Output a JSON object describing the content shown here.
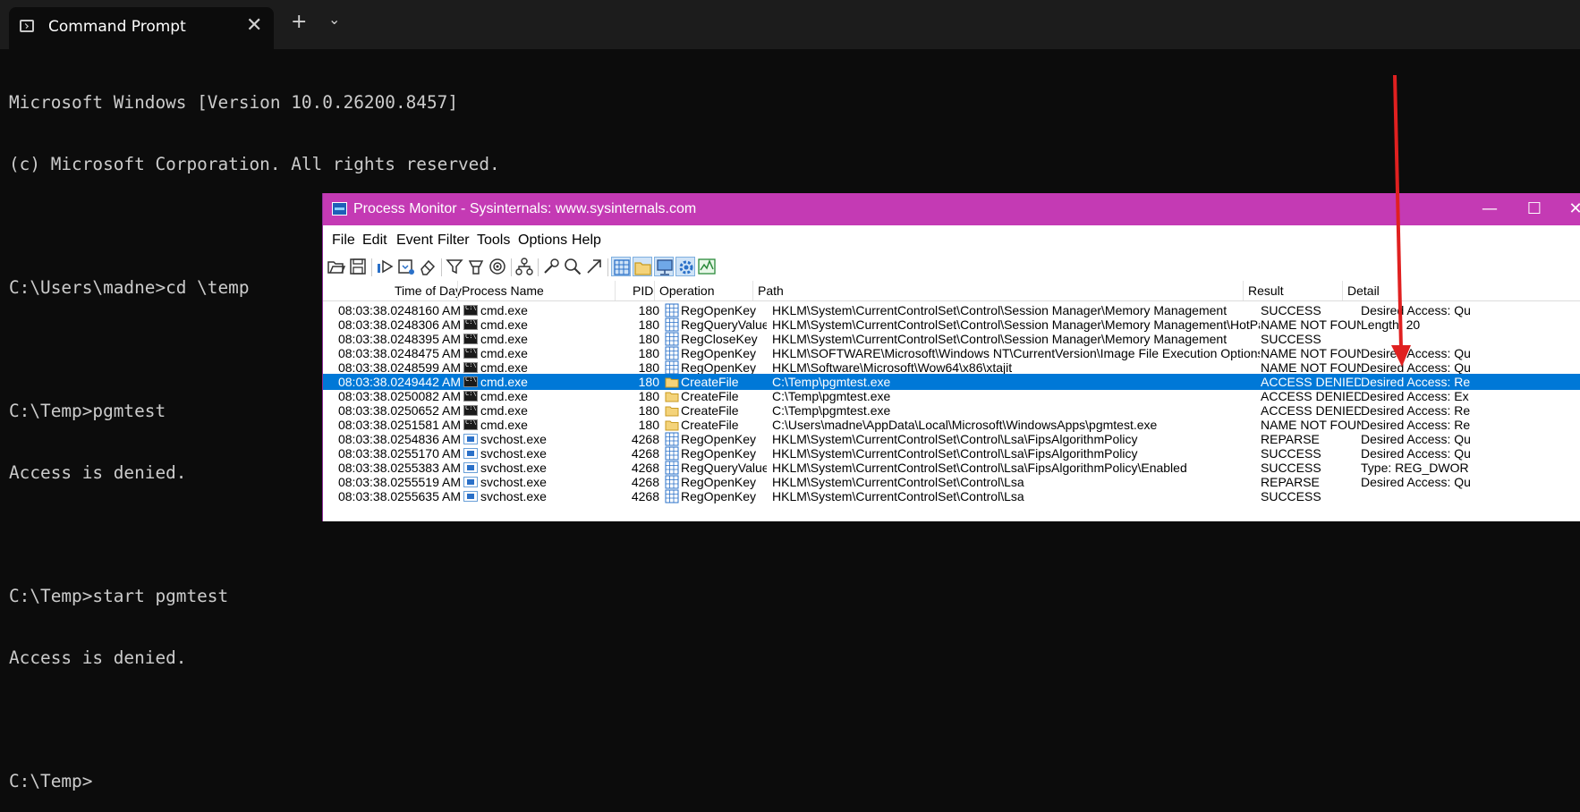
{
  "terminal": {
    "tab_title": "Command Prompt",
    "tab_icon": "terminal-icon",
    "close_glyph": "✕",
    "new_tab_glyph": "+",
    "dropdown_glyph": "⌄",
    "lines": [
      "Microsoft Windows [Version 10.0.26200.8457]",
      "(c) Microsoft Corporation. All rights reserved.",
      "",
      "C:\\Users\\madne>cd \\temp",
      "",
      "C:\\Temp>pgmtest",
      "Access is denied.",
      "",
      "C:\\Temp>start pgmtest",
      "Access is denied.",
      "",
      "C:\\Temp>"
    ]
  },
  "procmon": {
    "title": "Process Monitor - Sysinternals: www.sysinternals.com",
    "window_buttons": {
      "minimize": "—",
      "maximize": "☐",
      "close": "✕"
    },
    "menu": [
      "File",
      "Edit",
      "Event",
      "Filter",
      "Tools",
      "Options",
      "Help"
    ],
    "toolbar_icons": [
      "open-icon",
      "save-icon",
      "capture-icon",
      "autoscroll-icon",
      "clear-icon",
      "filter-icon",
      "highlight-icon",
      "target-icon",
      "process-tree-icon",
      "properties-icon",
      "find-icon",
      "jump-icon",
      "registry-activity-icon",
      "file-activity-icon",
      "network-activity-icon",
      "process-activity-icon",
      "profiling-icon"
    ],
    "columns": {
      "time": "Time of Day",
      "process": "Process Name",
      "pid": "PID",
      "operation": "Operation",
      "path": "Path",
      "result": "Result",
      "detail": "Detail"
    },
    "colors": {
      "title_bar": "#c43ab4",
      "selection": "#0078d7",
      "annotation_arrow": "#e02020"
    },
    "rows": [
      {
        "time": "08:03:38.0248160 AM",
        "process": "cmd.exe",
        "pid": "180",
        "op": "RegOpenKey",
        "kind": "reg",
        "path": "HKLM\\System\\CurrentControlSet\\Control\\Session Manager\\Memory Management",
        "result": "SUCCESS",
        "detail": "Desired Access: Qu"
      },
      {
        "time": "08:03:38.0248306 AM",
        "process": "cmd.exe",
        "pid": "180",
        "op": "RegQueryValue",
        "kind": "reg",
        "path": "HKLM\\System\\CurrentControlSet\\Control\\Session Manager\\Memory Management\\HotPatchRestrictions",
        "result": "NAME NOT FOUND",
        "detail": "Length: 20"
      },
      {
        "time": "08:03:38.0248395 AM",
        "process": "cmd.exe",
        "pid": "180",
        "op": "RegCloseKey",
        "kind": "reg",
        "path": "HKLM\\System\\CurrentControlSet\\Control\\Session Manager\\Memory Management",
        "result": "SUCCESS",
        "detail": ""
      },
      {
        "time": "08:03:38.0248475 AM",
        "process": "cmd.exe",
        "pid": "180",
        "op": "RegOpenKey",
        "kind": "reg",
        "path": "HKLM\\SOFTWARE\\Microsoft\\Windows NT\\CurrentVersion\\Image File Execution Options\\pgmtest.exe",
        "result": "NAME NOT FOUND",
        "detail": "Desired Access: Qu"
      },
      {
        "time": "08:03:38.0248599 AM",
        "process": "cmd.exe",
        "pid": "180",
        "op": "RegOpenKey",
        "kind": "reg",
        "path": "HKLM\\Software\\Microsoft\\Wow64\\x86\\xtajit",
        "result": "NAME NOT FOUND",
        "detail": "Desired Access: Qu"
      },
      {
        "time": "08:03:38.0249442 AM",
        "process": "cmd.exe",
        "pid": "180",
        "op": "CreateFile",
        "kind": "file",
        "path": "C:\\Temp\\pgmtest.exe",
        "result": "ACCESS DENIED",
        "detail": "Desired Access: Re",
        "selected": true
      },
      {
        "time": "08:03:38.0250082 AM",
        "process": "cmd.exe",
        "pid": "180",
        "op": "CreateFile",
        "kind": "file",
        "path": "C:\\Temp\\pgmtest.exe",
        "result": "ACCESS DENIED",
        "detail": "Desired Access: Ex"
      },
      {
        "time": "08:03:38.0250652 AM",
        "process": "cmd.exe",
        "pid": "180",
        "op": "CreateFile",
        "kind": "file",
        "path": "C:\\Temp\\pgmtest.exe",
        "result": "ACCESS DENIED",
        "detail": "Desired Access: Re"
      },
      {
        "time": "08:03:38.0251581 AM",
        "process": "cmd.exe",
        "pid": "180",
        "op": "CreateFile",
        "kind": "file",
        "path": "C:\\Users\\madne\\AppData\\Local\\Microsoft\\WindowsApps\\pgmtest.exe",
        "result": "NAME NOT FOUND",
        "detail": "Desired Access: Re"
      },
      {
        "time": "08:03:38.0254836 AM",
        "process": "svchost.exe",
        "pid": "4268",
        "op": "RegOpenKey",
        "kind": "reg",
        "path": "HKLM\\System\\CurrentControlSet\\Control\\Lsa\\FipsAlgorithmPolicy",
        "result": "REPARSE",
        "detail": "Desired Access: Qu"
      },
      {
        "time": "08:03:38.0255170 AM",
        "process": "svchost.exe",
        "pid": "4268",
        "op": "RegOpenKey",
        "kind": "reg",
        "path": "HKLM\\System\\CurrentControlSet\\Control\\Lsa\\FipsAlgorithmPolicy",
        "result": "SUCCESS",
        "detail": "Desired Access: Qu"
      },
      {
        "time": "08:03:38.0255383 AM",
        "process": "svchost.exe",
        "pid": "4268",
        "op": "RegQueryValue",
        "kind": "reg",
        "path": "HKLM\\System\\CurrentControlSet\\Control\\Lsa\\FipsAlgorithmPolicy\\Enabled",
        "result": "SUCCESS",
        "detail": "Type: REG_DWOR"
      },
      {
        "time": "08:03:38.0255519 AM",
        "process": "svchost.exe",
        "pid": "4268",
        "op": "RegOpenKey",
        "kind": "reg",
        "path": "HKLM\\System\\CurrentControlSet\\Control\\Lsa",
        "result": "REPARSE",
        "detail": "Desired Access: Qu"
      },
      {
        "time": "08:03:38.0255635 AM",
        "process": "svchost.exe",
        "pid": "4268",
        "op": "RegOpenKey",
        "kind": "reg",
        "path": "HKLM\\System\\CurrentControlSet\\Control\\Lsa",
        "result": "SUCCESS",
        "detail": ""
      }
    ]
  }
}
